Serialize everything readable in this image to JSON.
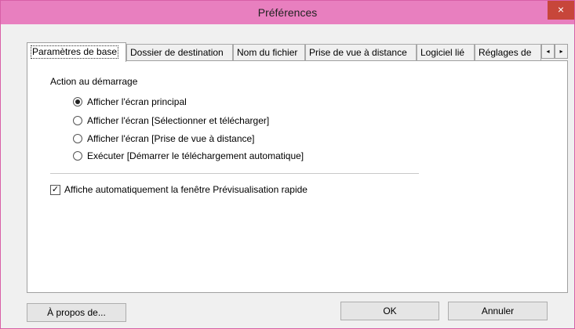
{
  "window": {
    "title": "Préférences",
    "close_glyph": "×"
  },
  "tabs": [
    {
      "label": "Paramètres de base",
      "active": true
    },
    {
      "label": "Dossier de destination",
      "active": false
    },
    {
      "label": "Nom du fichier",
      "active": false
    },
    {
      "label": "Prise de vue à distance",
      "active": false
    },
    {
      "label": "Logiciel lié",
      "active": false
    },
    {
      "label": "Réglages de",
      "active": false
    }
  ],
  "tab_scroll": {
    "left_glyph": "◂",
    "right_glyph": "▸"
  },
  "startup": {
    "section_label": "Action au démarrage",
    "options": [
      {
        "label": "Afficher l'écran principal",
        "checked": true
      },
      {
        "label": "Afficher l'écran [Sélectionner et télécharger]",
        "checked": false
      },
      {
        "label": "Afficher l'écran [Prise de vue à distance]",
        "checked": false
      },
      {
        "label": "Exécuter [Démarrer le téléchargement automatique]",
        "checked": false
      }
    ]
  },
  "quick_preview": {
    "label": "Affiche automatiquement la fenêtre Prévisualisation rapide",
    "checked": true,
    "check_glyph": "✓"
  },
  "buttons": {
    "about": "À propos de...",
    "ok": "OK",
    "cancel": "Annuler"
  },
  "colors": {
    "titlebar": "#e87fbf",
    "close_button": "#c7463a"
  }
}
